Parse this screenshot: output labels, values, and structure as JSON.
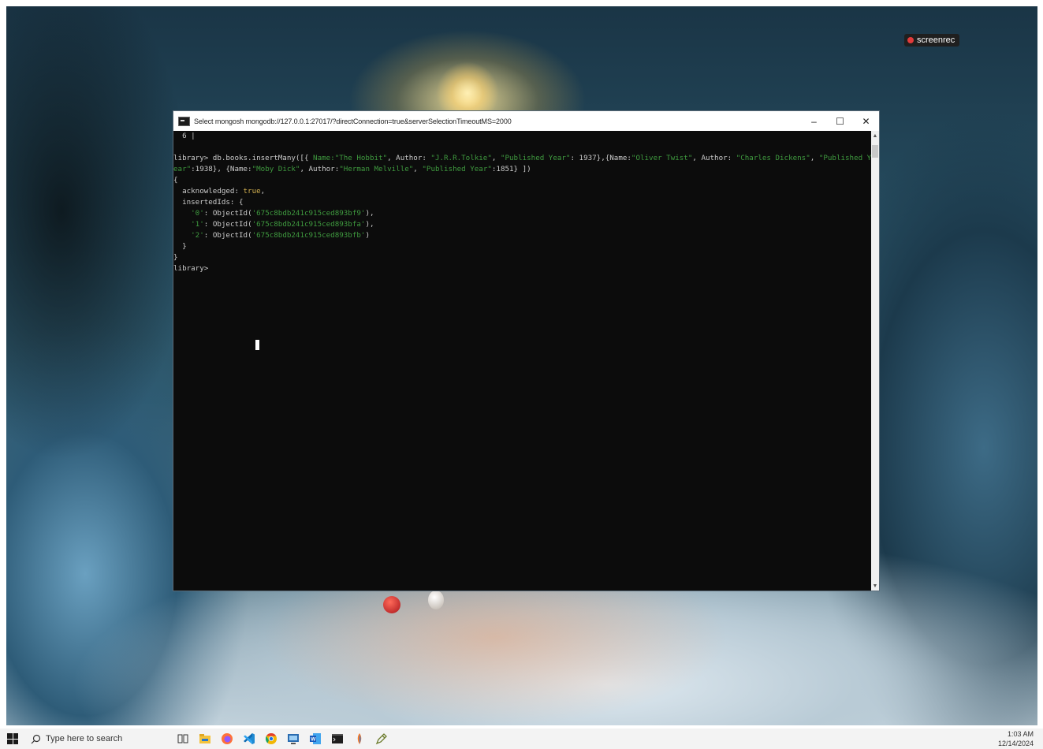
{
  "desktop": {
    "screenrec_label": "screenrec"
  },
  "window": {
    "title": "Select mongosh mongodb://127.0.0.1:27017/?directConnection=true&serverSelectionTimeoutMS=2000",
    "controls": {
      "minimize": "–",
      "maximize": "☐",
      "close": "✕"
    }
  },
  "console": {
    "line0": "  6 |",
    "prompt": "library>",
    "cmd_parts": {
      "a": " db.books.insertMany([{ ",
      "b": "Name:",
      "c": "\"The Hobbit\"",
      "d": ", Author: ",
      "e": "\"J.R.R.Tolkie\"",
      "f": ", ",
      "g": "\"Published Year\"",
      "h": ": 1937},{Name:",
      "i": "\"Oliver Twist\"",
      "j": ", Author: ",
      "k": "\"Charles Dickens\"",
      "l": ", ",
      "m": "\"Published Y"
    },
    "cmd2_parts": {
      "a": "ear\"",
      "b": ":1938}, {Name:",
      "c": "\"Moby Dick\"",
      "d": ", Author:",
      "e": "\"Herman Melville\"",
      "f": ", ",
      "g": "\"Published Year\"",
      "h": ":1851} ])"
    },
    "open_brace": "{",
    "ack_key": "  acknowledged: ",
    "ack_val": "true",
    "ack_end": ",",
    "ids_key": "  insertedIds: {",
    "ids": [
      {
        "pre": "    ",
        "idx": "'0'",
        "mid": ": ObjectId(",
        "val": "'675c8bdb241c915ced893bf9'",
        "end": "),"
      },
      {
        "pre": "    ",
        "idx": "'1'",
        "mid": ": ObjectId(",
        "val": "'675c8bdb241c915ced893bfa'",
        "end": "),"
      },
      {
        "pre": "    ",
        "idx": "'2'",
        "mid": ": ObjectId(",
        "val": "'675c8bdb241c915ced893bfb'",
        "end": ")"
      }
    ],
    "close_inner": "  }",
    "close_brace": "}",
    "final_prompt": "library>"
  },
  "taskbar": {
    "search_placeholder": "Type here to search",
    "time": "1:03 AM",
    "date": "12/14/2024",
    "apps": [
      "task-view-icon",
      "file-explorer-icon",
      "firefox-icon",
      "vscode-icon",
      "chrome-icon",
      "remote-desktop-icon",
      "word-icon",
      "terminal-icon",
      "mongodb-compass-icon",
      "pencil-app-icon"
    ]
  }
}
